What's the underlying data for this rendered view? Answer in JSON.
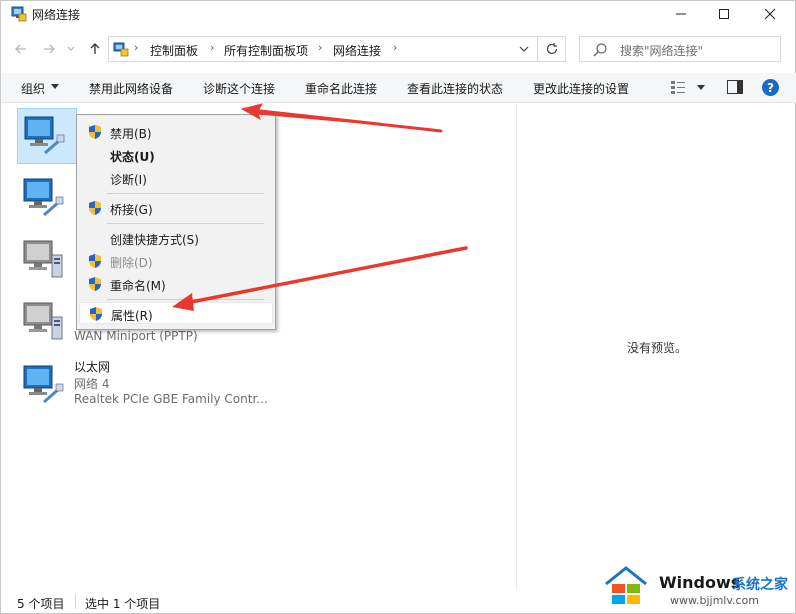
{
  "window": {
    "title": "网络连接"
  },
  "address": {
    "crumbs": [
      "控制面板",
      "所有控制面板项",
      "网络连接"
    ],
    "search_placeholder": "搜索\"网络连接\""
  },
  "toolbar": {
    "organize": "组织",
    "disable_device": "禁用此网络设备",
    "diagnose": "诊断这个连接",
    "rename": "重命名此连接",
    "view_status": "查看此连接的状态",
    "change_settings": "更改此连接的设置"
  },
  "connections": [
    {
      "line1": "",
      "line2": "",
      "line3": ""
    },
    {
      "line1": "",
      "line2": "",
      "line3": ""
    },
    {
      "line1": "",
      "line2": "",
      "line3": ""
    },
    {
      "line1": "",
      "line2": "",
      "line3": "WAN Miniport (PPTP)"
    },
    {
      "line1": "以太网",
      "line2": "网络 4",
      "line3": "Realtek PCIe GBE Family Contr..."
    }
  ],
  "context_menu": {
    "items": [
      {
        "label": "禁用(B)",
        "shield": true
      },
      {
        "label": "状态(U)",
        "bold": true
      },
      {
        "label": "诊断(I)"
      },
      {
        "label": "桥接(G)",
        "shield": true
      },
      {
        "label": "创建快捷方式(S)"
      },
      {
        "label": "删除(D)",
        "shield": true,
        "disabled": true
      },
      {
        "label": "重命名(M)",
        "shield": true
      },
      {
        "label": "属性(R)",
        "shield": true,
        "highlighted": true
      }
    ]
  },
  "preview": {
    "empty_text": "没有预览。"
  },
  "status_bar": {
    "item_count": "5 个项目",
    "selected_count": "选中 1 个项目"
  },
  "watermark": {
    "brand": "Windows",
    "brand_cn": "系统之家",
    "url": "www.bjjmlv.com"
  },
  "colors": {
    "selection_bg": "#cce8ff",
    "help_blue": "#1b6ac9",
    "annotation_red": "#e8392e"
  },
  "icons": {
    "title": "network-connections-icon",
    "shield": "uac-shield-icon",
    "help": "help-icon"
  }
}
